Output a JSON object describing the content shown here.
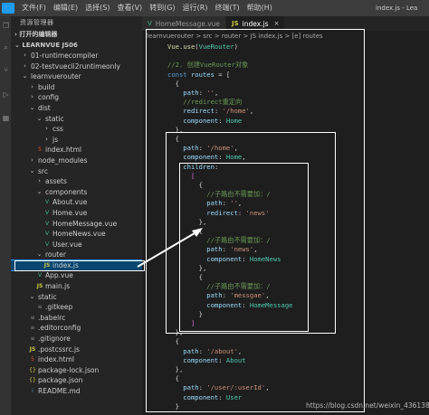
{
  "titlebar": {
    "menu": [
      "文件(F)",
      "编辑(E)",
      "选择(S)",
      "查看(V)",
      "转到(G)",
      "运行(R)",
      "终端(T)",
      "帮助(H)"
    ],
    "window_title": "index.js - Lea"
  },
  "sidebar": {
    "title": "资源管理器",
    "open_editors": "打开的编辑器",
    "project": "LEARNVUE JS06",
    "tree": [
      {
        "label": "01-runtimecompiler",
        "depth": 1,
        "type": "folder",
        "open": false
      },
      {
        "label": "02-testvuecli2runtimeonly",
        "depth": 1,
        "type": "folder",
        "open": false
      },
      {
        "label": "learnvuerouter",
        "depth": 1,
        "type": "folder",
        "open": true
      },
      {
        "label": "build",
        "depth": 2,
        "type": "folder",
        "open": false
      },
      {
        "label": "config",
        "depth": 2,
        "type": "folder",
        "open": false
      },
      {
        "label": "dist",
        "depth": 2,
        "type": "folder",
        "open": true
      },
      {
        "label": "static",
        "depth": 3,
        "type": "folder",
        "open": true
      },
      {
        "label": "css",
        "depth": 4,
        "type": "folder",
        "open": false
      },
      {
        "label": "js",
        "depth": 4,
        "type": "folder",
        "open": false
      },
      {
        "label": "index.html",
        "depth": 3,
        "type": "html"
      },
      {
        "label": "node_modules",
        "depth": 2,
        "type": "folder",
        "open": false
      },
      {
        "label": "src",
        "depth": 2,
        "type": "folder",
        "open": true
      },
      {
        "label": "assets",
        "depth": 3,
        "type": "folder",
        "open": false
      },
      {
        "label": "components",
        "depth": 3,
        "type": "folder",
        "open": true
      },
      {
        "label": "About.vue",
        "depth": 4,
        "type": "vue"
      },
      {
        "label": "Home.vue",
        "depth": 4,
        "type": "vue"
      },
      {
        "label": "HomeMessage.vue",
        "depth": 4,
        "type": "vue"
      },
      {
        "label": "HomeNews.vue",
        "depth": 4,
        "type": "vue"
      },
      {
        "label": "User.vue",
        "depth": 4,
        "type": "vue"
      },
      {
        "label": "router",
        "depth": 3,
        "type": "folder",
        "open": true
      },
      {
        "label": "index.js",
        "depth": 4,
        "type": "js",
        "selected": true
      },
      {
        "label": "App.vue",
        "depth": 3,
        "type": "vue"
      },
      {
        "label": "main.js",
        "depth": 3,
        "type": "js"
      },
      {
        "label": "static",
        "depth": 2,
        "type": "folder",
        "open": true
      },
      {
        "label": ".gitkeep",
        "depth": 3,
        "type": "misc"
      },
      {
        "label": ".babelrc",
        "depth": 2,
        "type": "misc"
      },
      {
        "label": ".editorconfig",
        "depth": 2,
        "type": "misc"
      },
      {
        "label": ".gitignore",
        "depth": 2,
        "type": "misc"
      },
      {
        "label": ".postcssrc.js",
        "depth": 2,
        "type": "js"
      },
      {
        "label": "index.html",
        "depth": 2,
        "type": "html"
      },
      {
        "label": "package-lock.json",
        "depth": 2,
        "type": "json"
      },
      {
        "label": "package.json",
        "depth": 2,
        "type": "json"
      },
      {
        "label": "README.md",
        "depth": 2,
        "type": "md"
      }
    ]
  },
  "editor": {
    "tabs": [
      {
        "label": "HomeMessage.vue",
        "icon": "V",
        "active": false
      },
      {
        "label": "index.js",
        "icon": "JS",
        "active": true
      }
    ],
    "breadcrumb": "learnvuerouter > src > router > JS index.js > [e] routes",
    "lines": [
      [
        [
          "fn",
          "Vue"
        ],
        [
          "pun",
          "."
        ],
        [
          "fn",
          "use"
        ],
        [
          "pun",
          "("
        ],
        [
          "cls",
          "VueRouter"
        ],
        [
          "pun",
          ")"
        ]
      ],
      [],
      [
        [
          "cmt",
          "//2. 创建VueRouter对象"
        ]
      ],
      [
        [
          "kw",
          "const "
        ],
        [
          "var",
          "routes"
        ],
        [
          "pun",
          " = ["
        ]
      ],
      [
        [
          "pun",
          "  {"
        ]
      ],
      [
        [
          "var",
          "    path"
        ],
        [
          "pun",
          ": "
        ],
        [
          "str",
          "''"
        ],
        [
          "pun",
          ","
        ]
      ],
      [
        [
          "cmt",
          "    //redirect重定向"
        ]
      ],
      [
        [
          "var",
          "    redirect"
        ],
        [
          "pun",
          ": "
        ],
        [
          "str",
          "'/home'"
        ],
        [
          "pun",
          ","
        ]
      ],
      [
        [
          "var",
          "    component"
        ],
        [
          "pun",
          ": "
        ],
        [
          "cls",
          "Home"
        ]
      ],
      [
        [
          "pun",
          "  },"
        ]
      ],
      [
        [
          "pun",
          "  {"
        ]
      ],
      [
        [
          "var",
          "    path"
        ],
        [
          "pun",
          ": "
        ],
        [
          "str",
          "'/home'"
        ],
        [
          "pun",
          ","
        ]
      ],
      [
        [
          "var",
          "    component"
        ],
        [
          "pun",
          ": "
        ],
        [
          "cls",
          "Home"
        ],
        [
          "pun",
          ","
        ]
      ],
      [
        [
          "var",
          "    children"
        ],
        [
          "pun",
          ":"
        ]
      ],
      [
        [
          "brk2",
          "      ["
        ]
      ],
      [
        [
          "pun",
          "        {"
        ]
      ],
      [
        [
          "cmt",
          "          //子路由不需要加：/"
        ]
      ],
      [
        [
          "var",
          "          path"
        ],
        [
          "pun",
          ": "
        ],
        [
          "str",
          "''"
        ],
        [
          "pun",
          ","
        ]
      ],
      [
        [
          "var",
          "          redirect"
        ],
        [
          "pun",
          ": "
        ],
        [
          "str",
          "'news'"
        ]
      ],
      [
        [
          "pun",
          "        },"
        ]
      ],
      [
        [
          "pun",
          "        {"
        ]
      ],
      [
        [
          "cmt",
          "          //子路由不需要加：/"
        ]
      ],
      [
        [
          "var",
          "          path"
        ],
        [
          "pun",
          ": "
        ],
        [
          "str",
          "'news'"
        ],
        [
          "pun",
          ","
        ]
      ],
      [
        [
          "var",
          "          component"
        ],
        [
          "pun",
          ": "
        ],
        [
          "cls",
          "HomeNews"
        ]
      ],
      [
        [
          "pun",
          "        },"
        ]
      ],
      [
        [
          "pun",
          "        {"
        ]
      ],
      [
        [
          "cmt",
          "          //子路由不需要加：/"
        ]
      ],
      [
        [
          "var",
          "          path"
        ],
        [
          "pun",
          ": "
        ],
        [
          "str",
          "'messgae'"
        ],
        [
          "pun",
          ","
        ]
      ],
      [
        [
          "var",
          "          component"
        ],
        [
          "pun",
          ": "
        ],
        [
          "cls",
          "HomeMessage"
        ]
      ],
      [
        [
          "pun",
          "        }"
        ]
      ],
      [
        [
          "brk2",
          "      ]"
        ]
      ],
      [
        [
          "pun",
          "  },"
        ]
      ],
      [
        [
          "pun",
          "  {"
        ]
      ],
      [
        [
          "var",
          "    path"
        ],
        [
          "pun",
          ": "
        ],
        [
          "str",
          "'/about'"
        ],
        [
          "pun",
          ","
        ]
      ],
      [
        [
          "var",
          "    component"
        ],
        [
          "pun",
          ": "
        ],
        [
          "cls",
          "About"
        ]
      ],
      [
        [
          "pun",
          "  },"
        ]
      ],
      [
        [
          "pun",
          "  {"
        ]
      ],
      [
        [
          "var",
          "    path"
        ],
        [
          "pun",
          ": "
        ],
        [
          "str",
          "'/user/:userId'"
        ],
        [
          "pun",
          ","
        ]
      ],
      [
        [
          "var",
          "    component"
        ],
        [
          "pun",
          ": "
        ],
        [
          "cls",
          "User"
        ]
      ],
      [
        [
          "pun",
          "  }"
        ]
      ]
    ]
  },
  "watermark": "https://blog.csdn.net/weixin_43613849"
}
